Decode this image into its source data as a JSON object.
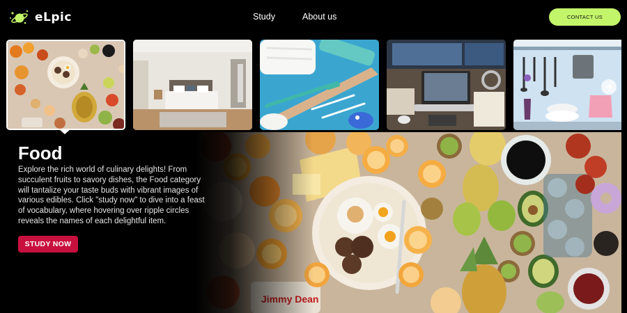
{
  "brand": {
    "name": "eLpic",
    "logo_icon": "planet-icon",
    "accent": "#c3f56a"
  },
  "nav": {
    "items": [
      {
        "label": "Study"
      },
      {
        "label": "About us"
      }
    ],
    "contact_label": "CONTACT US"
  },
  "categories": [
    {
      "id": "food",
      "icon": "food-image",
      "active": true
    },
    {
      "id": "bedroom",
      "icon": "bedroom-image",
      "active": false
    },
    {
      "id": "bathroom",
      "icon": "bathroom-image",
      "active": false
    },
    {
      "id": "office",
      "icon": "office-desk-image",
      "active": false
    },
    {
      "id": "kitchen",
      "icon": "kitchen-image",
      "active": false
    }
  ],
  "hero": {
    "title": "Food",
    "description": "Explore the rich world of culinary delights! From succulent fruits to savory dishes, the Food category will tantalize your taste buds with vibrant images of various edibles. Click \"study now\" to dive into a feast of vocabulary, where hovering over ripple circles reveals the names of each delightful item.",
    "cta_label": "STUDY NOW",
    "cta_color": "#c8103e"
  }
}
